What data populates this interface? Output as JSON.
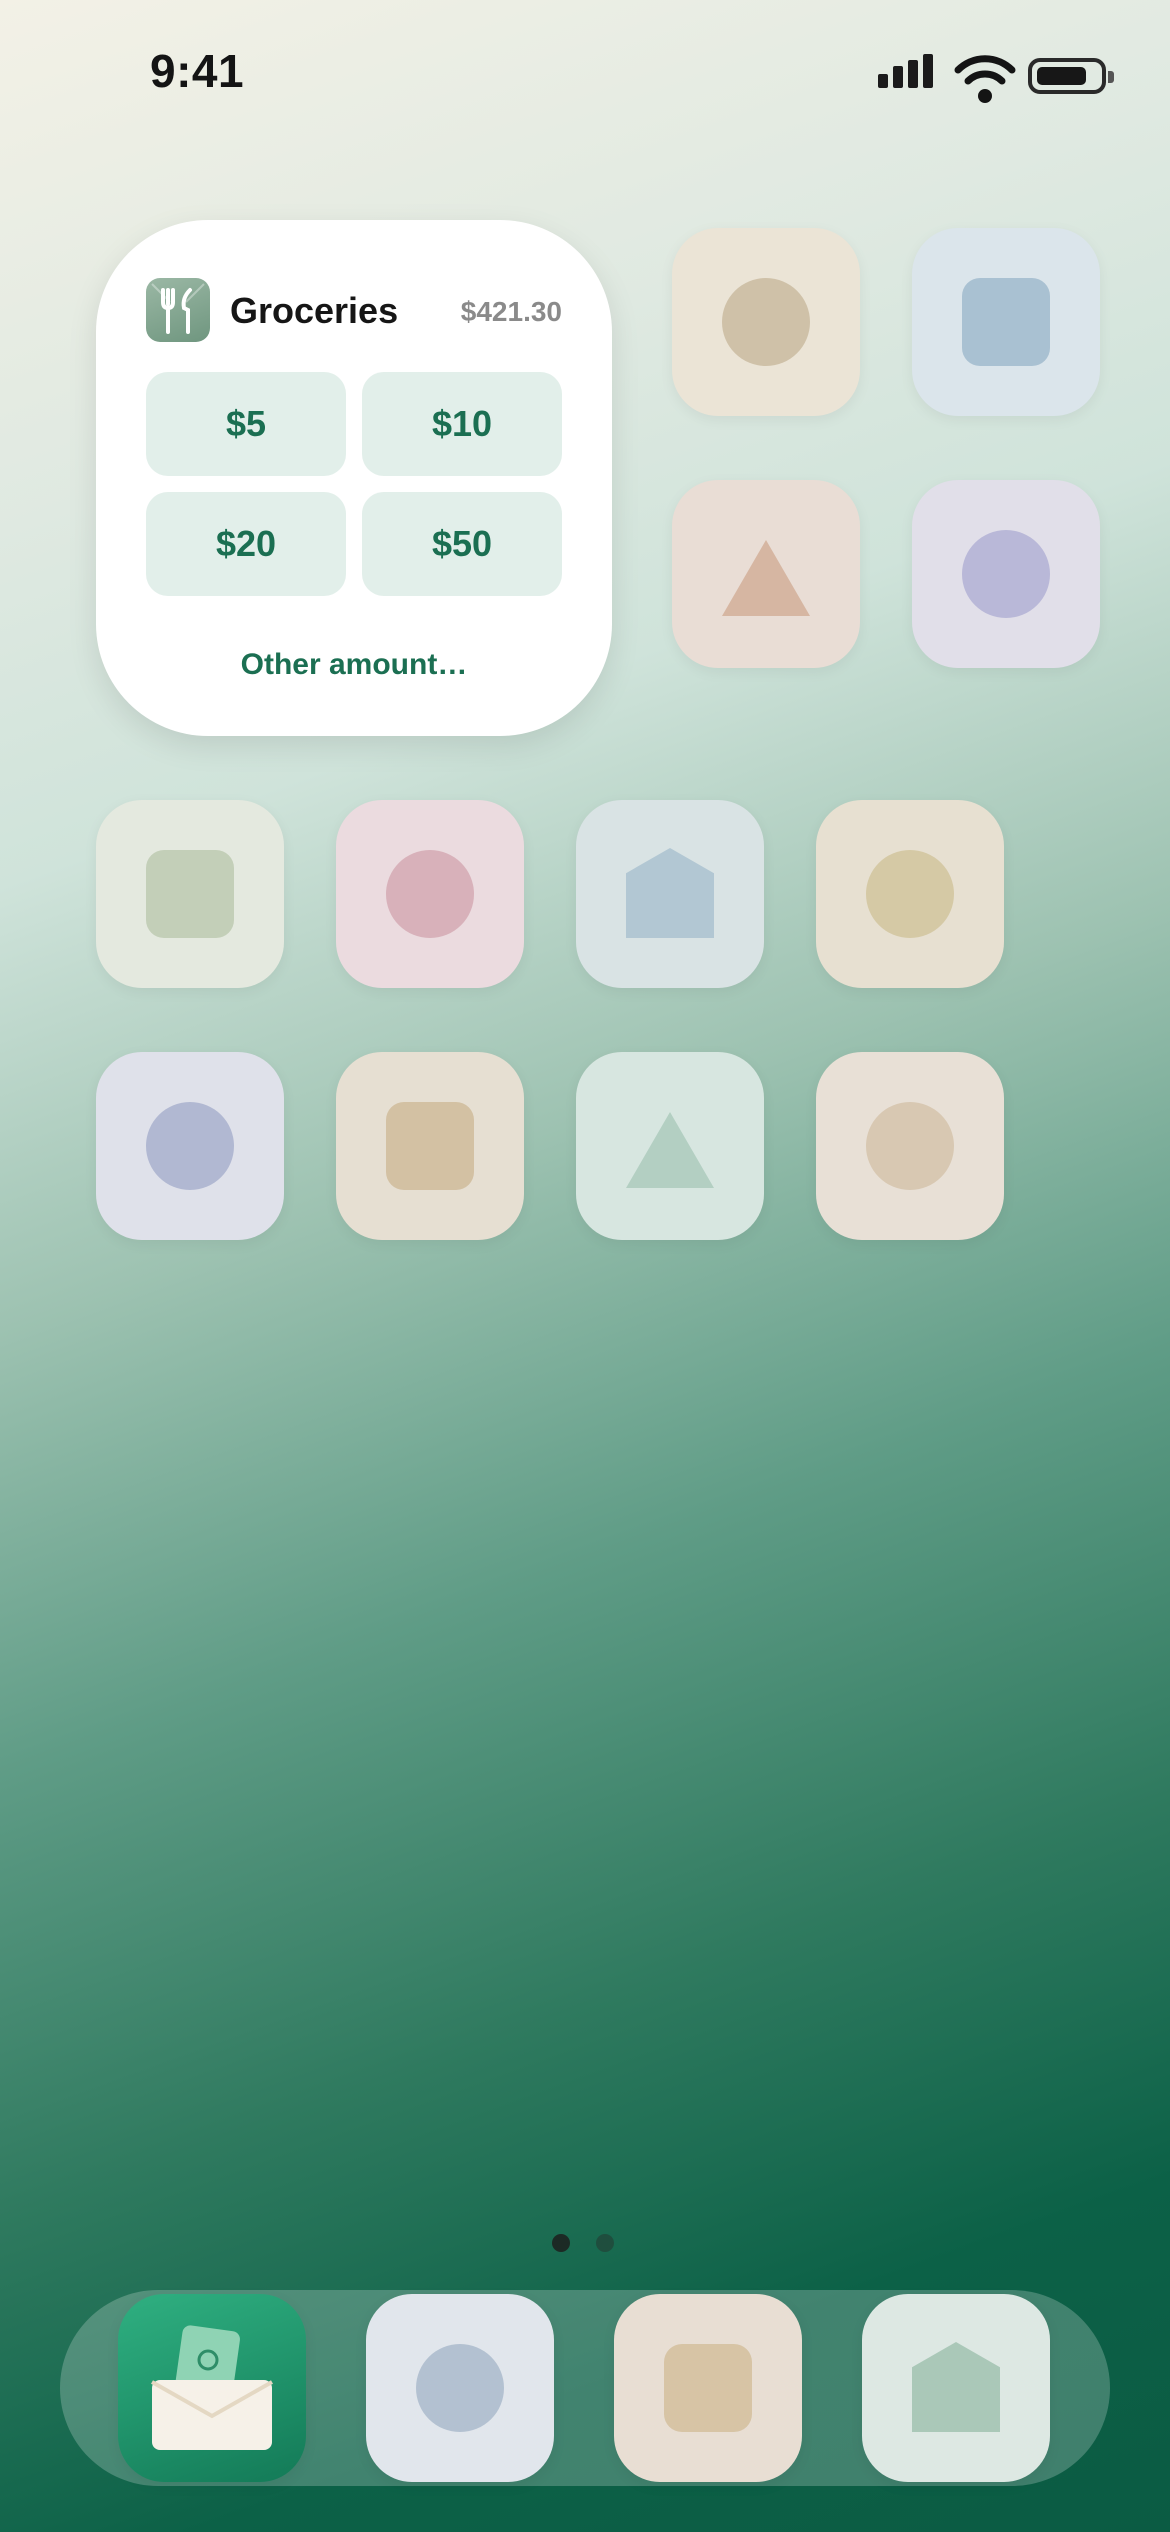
{
  "status_bar": {
    "time": "9:41",
    "signal_icon": "cellular-signal-icon",
    "wifi_icon": "wifi-icon",
    "battery_icon": "battery-icon"
  },
  "widget": {
    "icon": "fork-knife-icon",
    "title": "Groceries",
    "balance": "$421.30",
    "amounts": [
      "$5",
      "$10",
      "$20",
      "$50"
    ],
    "other_label": "Other amount…",
    "accent_color": "#1b6f52"
  },
  "home_apps": [
    {
      "shape": "circle",
      "bg": "#ebe4d6",
      "fg": "#cfc1a8"
    },
    {
      "shape": "square",
      "bg": "#dbe5eb",
      "fg": "#a9c1d2"
    },
    {
      "shape": "triangle",
      "bg": "#e9ddd5",
      "fg": "#d6b6a2"
    },
    {
      "shape": "circle",
      "bg": "#e1dfe9",
      "fg": "#b9b8d8"
    },
    {
      "shape": "square",
      "bg": "#e4e9df",
      "fg": "#c3cfb8"
    },
    {
      "shape": "circle",
      "bg": "#ebdbdf",
      "fg": "#d8b1ba"
    },
    {
      "shape": "house",
      "bg": "#d9e3e4",
      "fg": "#b2c7d3"
    },
    {
      "shape": "circle",
      "bg": "#e7e0d1",
      "fg": "#d5c9a5"
    },
    {
      "shape": "circle",
      "bg": "#dfe1ea",
      "fg": "#b1b8d2"
    },
    {
      "shape": "square",
      "bg": "#e6dfd2",
      "fg": "#d3c1a3"
    },
    {
      "shape": "triangle",
      "bg": "#d7e6e0",
      "fg": "#b3cfc2"
    },
    {
      "shape": "circle",
      "bg": "#e8e0d6",
      "fg": "#d8c8b2"
    }
  ],
  "page_dots": {
    "count": 2,
    "active": 0
  },
  "dock": [
    {
      "name": "wallet-envelope-app",
      "icon": "envelope-money-icon"
    },
    {
      "shape": "circle",
      "bg": "#e1e6ec",
      "fg": "#b3c1d1"
    },
    {
      "shape": "square",
      "bg": "#e8ded3",
      "fg": "#d7c4a5"
    },
    {
      "shape": "house",
      "bg": "#dde8e3",
      "fg": "#aac8b8"
    }
  ]
}
